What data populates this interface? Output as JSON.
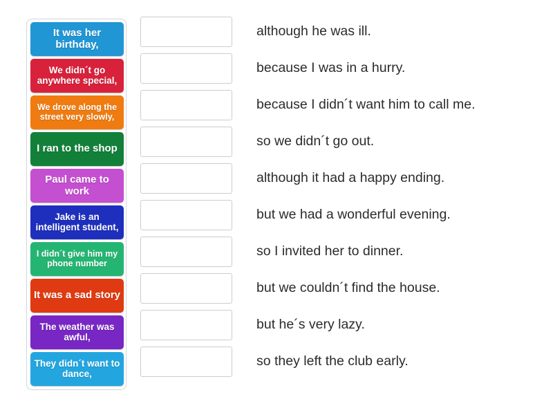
{
  "activity": {
    "type": "match-up",
    "tiles_panel_label": "draggable sentence starters",
    "rows_panel_label": "answer drop zones with sentence endings"
  },
  "tiles": [
    {
      "text": "It was her birthday,",
      "color": "#2196d4",
      "size": "size-lg"
    },
    {
      "text": "We didn´t go anywhere special,",
      "color": "#d8223c",
      "size": "size-md"
    },
    {
      "text": "We drove along the street very slowly,",
      "color": "#f07b10",
      "size": "size-sm"
    },
    {
      "text": "I ran to the shop",
      "color": "#13803a",
      "size": "size-lg"
    },
    {
      "text": "Paul came to work",
      "color": "#c44fd0",
      "size": "size-lg"
    },
    {
      "text": "Jake is an intelligent student,",
      "color": "#1e2fbe",
      "size": "size-md"
    },
    {
      "text": "I didn´t give him my phone number",
      "color": "#25b573",
      "size": "size-sm"
    },
    {
      "text": "It was a sad story",
      "color": "#e03a12",
      "size": "size-lg"
    },
    {
      "text": "The weather was awful,",
      "color": "#7826c4",
      "size": "size-md"
    },
    {
      "text": "They didn´t want to dance,",
      "color": "#23a6e0",
      "size": "size-md"
    }
  ],
  "rows": [
    {
      "dropzone_value": "",
      "answer": "although he was ill."
    },
    {
      "dropzone_value": "",
      "answer": "because I was in a hurry."
    },
    {
      "dropzone_value": "",
      "answer": "because I didn´t want him to call me."
    },
    {
      "dropzone_value": "",
      "answer": "so we didn´t go out."
    },
    {
      "dropzone_value": "",
      "answer": "although it had a happy ending."
    },
    {
      "dropzone_value": "",
      "answer": "but we had a wonderful evening."
    },
    {
      "dropzone_value": "",
      "answer": "so I invited her to dinner."
    },
    {
      "dropzone_value": "",
      "answer": "but we couldn´t find the house."
    },
    {
      "dropzone_value": "",
      "answer": "but he´s very lazy."
    },
    {
      "dropzone_value": "",
      "answer": "so they left the club early."
    }
  ],
  "colors": {
    "page_background": "#ffffff",
    "panel_border": "#d2d6d9",
    "dropzone_border": "#c9cdd0",
    "answer_text": "#2b2b2b",
    "tile_text": "#ffffff"
  }
}
